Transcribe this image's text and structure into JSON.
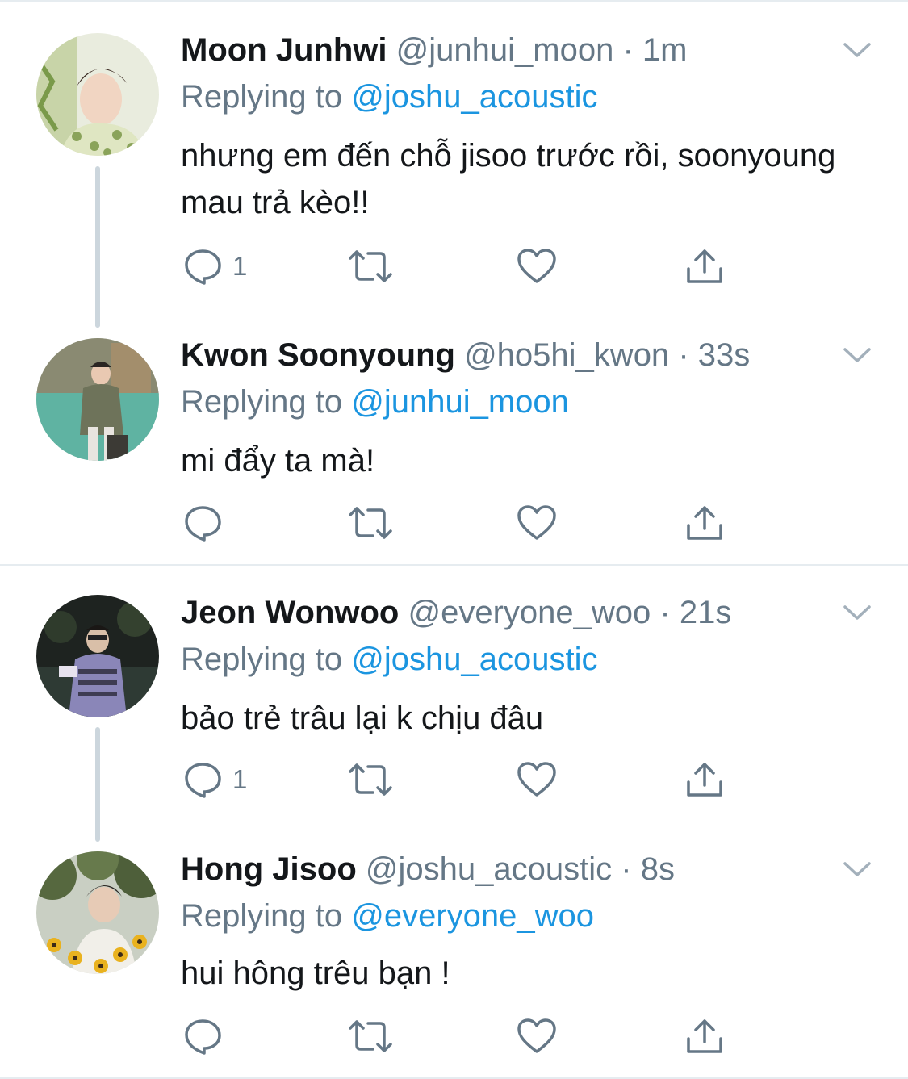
{
  "tweets": [
    {
      "display_name": "Moon Junhwi",
      "handle": "@junhui_moon",
      "separator": "·",
      "time": "1m",
      "replying_prefix": "Replying to",
      "replying_to": "@joshu_acoustic",
      "text": "nhưng em đến chỗ jisoo trước rồi, soonyoung mau trả kèo!!",
      "reply_count": "1",
      "avatar_icon": "profile-photo"
    },
    {
      "display_name": "Kwon Soonyoung",
      "handle": "@ho5hi_kwon",
      "separator": "·",
      "time": "33s",
      "replying_prefix": "Replying to",
      "replying_to": "@junhui_moon",
      "text": "mi đẩy ta mà!",
      "reply_count": "",
      "avatar_icon": "profile-photo"
    },
    {
      "display_name": "Jeon Wonwoo",
      "handle": "@everyone_woo",
      "separator": "·",
      "time": "21s",
      "replying_prefix": "Replying to",
      "replying_to": "@joshu_acoustic",
      "text": "bảo trẻ trâu lại k chịu đâu",
      "reply_count": "1",
      "avatar_icon": "profile-photo"
    },
    {
      "display_name": "Hong Jisoo",
      "handle": "@joshu_acoustic",
      "separator": "·",
      "time": "8s",
      "replying_prefix": "Replying to",
      "replying_to": "@everyone_woo",
      "text": "hui hông trêu bạn !",
      "reply_count": "",
      "avatar_icon": "profile-photo"
    }
  ],
  "icons": {
    "reply": "reply-icon",
    "retweet": "retweet-icon",
    "like": "heart-icon",
    "share": "share-icon",
    "more": "chevron-down-icon"
  },
  "colors": {
    "link": "#1b95e0",
    "secondary_text": "#657786",
    "primary_text": "#14171a",
    "border": "#e6ecf0",
    "thread_line": "#ccd6dd"
  }
}
